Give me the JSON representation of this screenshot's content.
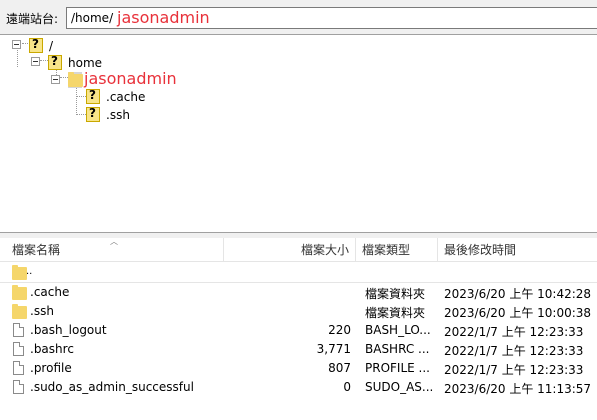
{
  "pathbar": {
    "label": "遠端站台:",
    "path_prefix": "/home/",
    "redacted_user": "jasonadmin"
  },
  "tree": {
    "root": "/",
    "home": "home",
    "user": "jasonadmin",
    "children": [
      ".cache",
      ".ssh"
    ]
  },
  "list": {
    "columns": {
      "name": "檔案名稱",
      "size": "檔案大小",
      "type": "檔案類型",
      "modified": "最後修改時間"
    },
    "up_entry": "..",
    "rows": [
      {
        "name": ".cache",
        "size": "",
        "type": "檔案資料夾",
        "modified": "2023/6/20 上午 10:42:28",
        "icon": "folder"
      },
      {
        "name": ".ssh",
        "size": "",
        "type": "檔案資料夾",
        "modified": "2023/6/20 上午 10:00:38",
        "icon": "folder"
      },
      {
        "name": ".bash_logout",
        "size": "220",
        "type": "BASH_LO...",
        "modified": "2022/1/7 上午 12:23:33",
        "icon": "file"
      },
      {
        "name": ".bashrc",
        "size": "3,771",
        "type": "BASHRC ...",
        "modified": "2022/1/7 上午 12:23:33",
        "icon": "file"
      },
      {
        "name": ".profile",
        "size": "807",
        "type": "PROFILE ...",
        "modified": "2022/1/7 上午 12:23:33",
        "icon": "file"
      },
      {
        "name": ".sudo_as_admin_successful",
        "size": "0",
        "type": "SUDO_AS...",
        "modified": "2023/6/20 上午 11:13:57",
        "icon": "file"
      }
    ]
  },
  "colors": {
    "redaction": "#e8313a",
    "folder": "#f5d66b",
    "unknown_folder": "#f8e58a"
  }
}
